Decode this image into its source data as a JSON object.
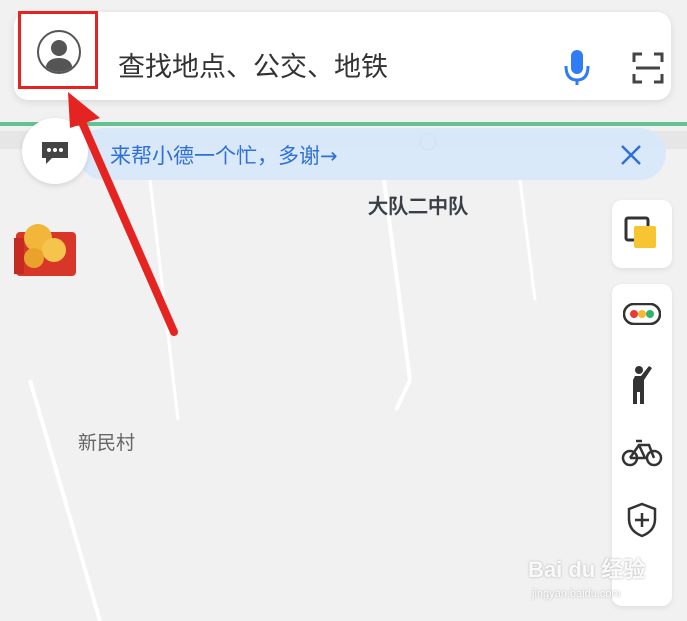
{
  "search": {
    "placeholder": "查找地点、公交、地铁",
    "avatar_icon": "user-avatar-icon",
    "mic_icon": "microphone-icon",
    "scan_icon": "scan-icon"
  },
  "banner": {
    "text": "来帮小德一个忙，多谢→",
    "close_icon": "close-icon",
    "message_icon": "message-bubble-icon"
  },
  "map": {
    "labels": {
      "dadui": "大队二中队",
      "xinmin": "新民村"
    }
  },
  "right_rail": {
    "items": [
      {
        "icon": "layers-icon"
      },
      {
        "icon": "traffic-light-icon"
      },
      {
        "icon": "taxi-hail-icon"
      },
      {
        "icon": "bike-icon"
      },
      {
        "icon": "shield-plus-icon"
      }
    ]
  },
  "watermark": {
    "brand": "Bai du 经验",
    "sub": "jingyan.baidu.com"
  },
  "colors": {
    "accent_blue": "#2f6fd6",
    "highlight_red": "#e52421",
    "banner_bg": "#d6e7fa"
  }
}
